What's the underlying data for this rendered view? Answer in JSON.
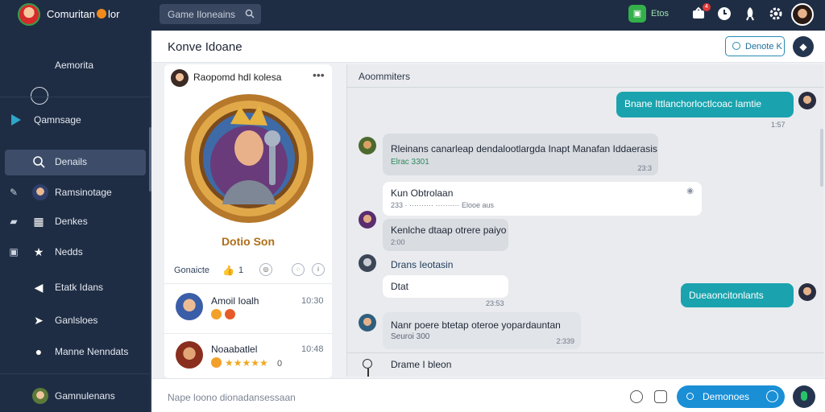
{
  "app": {
    "title": "Comuritan",
    "title_suffix": "lor"
  },
  "search": {
    "placeholder": "Game Iloneains"
  },
  "topbar": {
    "green_label": "Etos",
    "notif_count": "4"
  },
  "sidebar": {
    "items": [
      {
        "label": "Aemorita",
        "icon": "compass-icon"
      },
      {
        "label": "Qamnsage",
        "icon": "play-icon"
      },
      {
        "label": "Denails",
        "icon": "search-icon",
        "active": true
      },
      {
        "label": "Ramsinotage",
        "icon": "avatar-icon"
      },
      {
        "label": "Denkes",
        "icon": "grid-icon"
      },
      {
        "label": "Nedds",
        "icon": "star-icon"
      },
      {
        "label": "Etatk Idans",
        "icon": "megaphone-icon"
      },
      {
        "label": "Ganlsloes",
        "icon": "send-icon"
      },
      {
        "label": "Manne Nenndats",
        "icon": "chat-icon"
      },
      {
        "label": "Gamnulenans",
        "icon": "user-icon"
      }
    ]
  },
  "header": {
    "title": "Konve Idoane",
    "button_label": "Denote K"
  },
  "profile": {
    "name": "Raopomd hdl kolesa",
    "hero_name": "Dotio Son",
    "stats_label": "Gonaicte",
    "likes": "1",
    "friends": [
      {
        "name": "Amoil Ioalh",
        "time": "10:30"
      },
      {
        "name": "Noaabatlel",
        "time": "10:48",
        "rating": 5,
        "rating_label": "0"
      }
    ]
  },
  "chat": {
    "title": "Aoommiters",
    "messages": [
      {
        "dir": "out",
        "text": "Bnane    Ittlanchorloctlcoac Iamtie",
        "time": "1:57"
      },
      {
        "dir": "in",
        "text": "Rleinans canarleap dendalootlargda Inapt Manafan Iddaerasis",
        "sub": "Elrac 3301",
        "time": "23:3"
      },
      {
        "dir": "in-white",
        "text": "Kun Obtrolaan",
        "sub": "233 ·  ··········  ·········· Elooe aus",
        "time": ""
      },
      {
        "dir": "in",
        "text": "Kenlche dtaap otrere paiyo",
        "time": "2:00"
      },
      {
        "dir": "in-named",
        "text": "Drans Ieotasin",
        "sub": "Dtat",
        "time": "23:53"
      },
      {
        "dir": "out",
        "text": "Dueaoncitonlants",
        "time": ""
      },
      {
        "dir": "in",
        "text": "Nanr poere btetap oteroe yopardauntan",
        "sub": "Seuroi 300",
        "time": "2:339"
      },
      {
        "dir": "in-named",
        "text": "Drame I bleon",
        "sub": "",
        "time": ""
      }
    ]
  },
  "input": {
    "placeholder": "Nape loono dionadansessaan",
    "send_label": "Demonoes"
  },
  "colors": {
    "accent": "#1aa3ae",
    "sidebar": "#1f2d44",
    "send": "#1a8fd6"
  }
}
